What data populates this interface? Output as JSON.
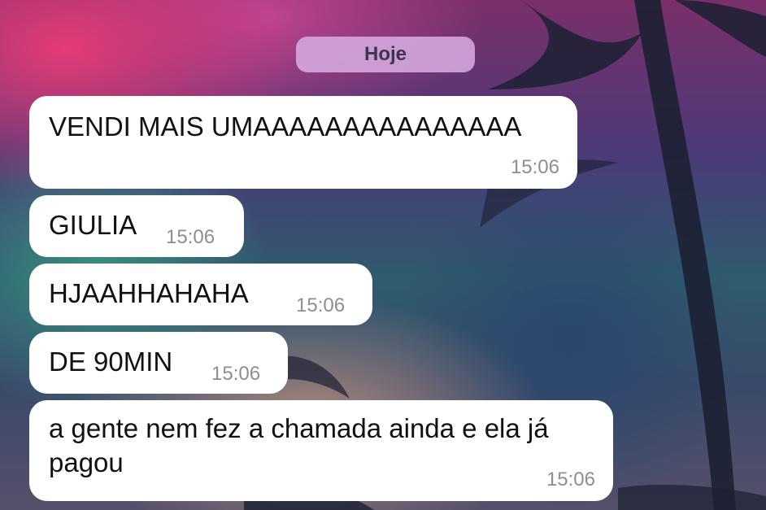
{
  "date_separator": "Hoje",
  "messages": [
    {
      "text": "VENDI MAIS UMAAAAAAAAAAAAAAA",
      "time": "15:06"
    },
    {
      "text": "GIULIA",
      "time": "15:06"
    },
    {
      "text": "HJAAHHAHAHA",
      "time": "15:06"
    },
    {
      "text": "DE 90MIN",
      "time": "15:06"
    },
    {
      "text": "a gente nem fez a chamada ainda e ela já pagou",
      "time": "15:06"
    }
  ],
  "colors": {
    "bubble": "#ffffff",
    "timestamp": "#8e8e93",
    "date_pill": "#d7aae1"
  }
}
